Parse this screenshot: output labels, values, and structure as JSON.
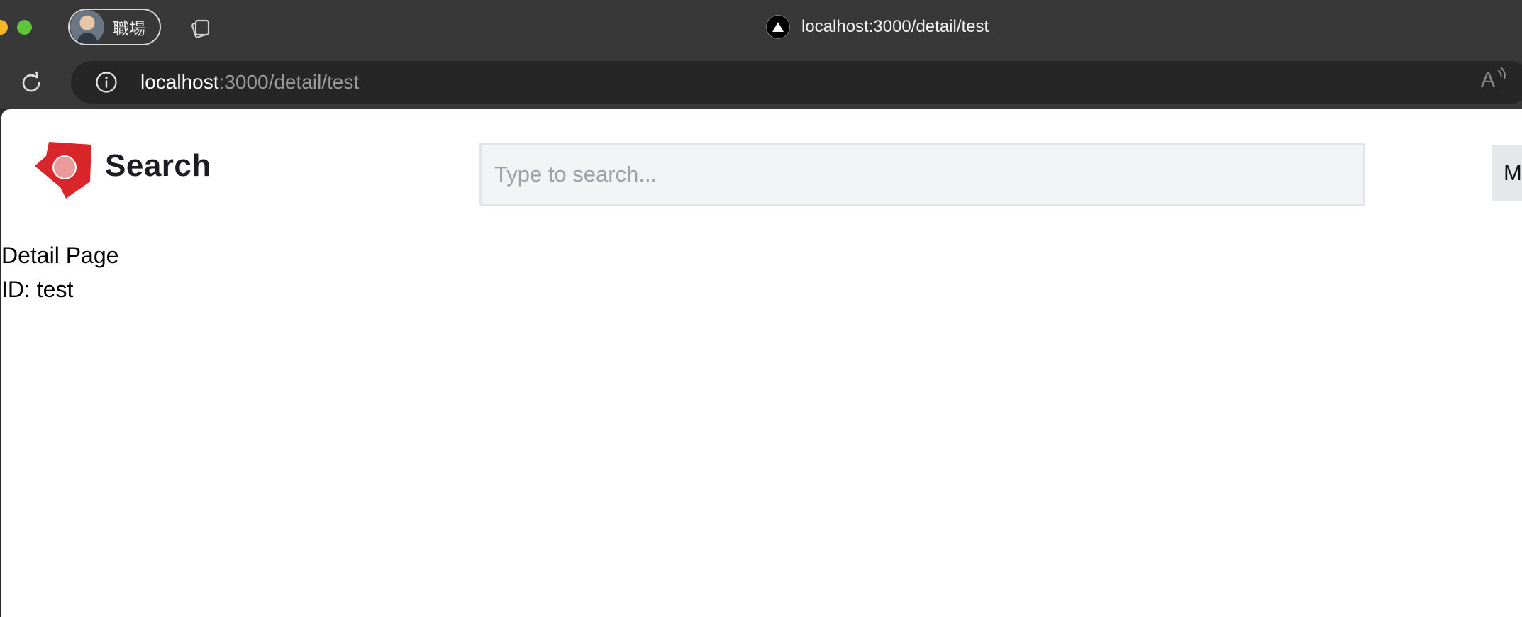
{
  "browser": {
    "profile_name": "職場",
    "tab_title": "localhost:3000/detail/test",
    "url_host": "localhost",
    "url_rest": ":3000/detail/test"
  },
  "app": {
    "title": "Search",
    "search_placeholder": "Type to search...",
    "menu_label": "M"
  },
  "page": {
    "heading": "Detail Page",
    "id_label": "ID:",
    "id_value": "test"
  },
  "colors": {
    "logo_red": "#d8262b",
    "logo_circle": "#e99a9a",
    "chrome_bg": "#383838"
  },
  "icons": [
    "tabs-icon",
    "favicon-triangle-icon",
    "reload-icon",
    "info-icon",
    "read-aloud-icon",
    "app-logo-icon"
  ]
}
